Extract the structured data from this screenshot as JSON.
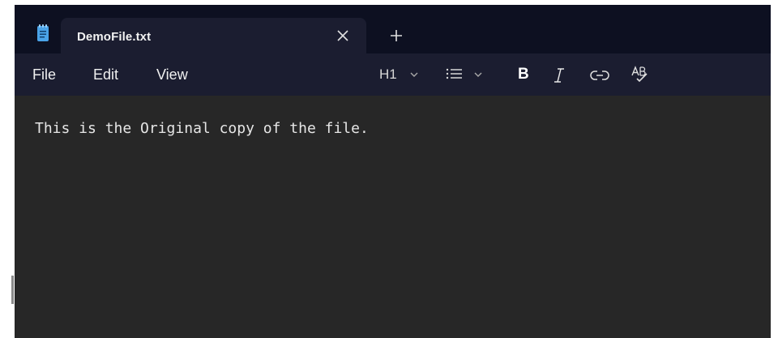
{
  "window": {
    "tab_title": "DemoFile.txt"
  },
  "menu": {
    "items": [
      "File",
      "Edit",
      "View"
    ]
  },
  "toolbar": {
    "heading_label": "H1",
    "bold_label": "B"
  },
  "editor": {
    "content": "This is the Original copy of the file."
  },
  "icons": {
    "app": "notepad-icon",
    "close": "close-icon",
    "new_tab": "plus-icon",
    "heading_dropdown": "chevron-down-icon",
    "list": "list-icon",
    "list_dropdown": "chevron-down-icon",
    "italic": "italic-icon",
    "link": "link-icon",
    "spellcheck": "spellcheck-icon"
  },
  "colors": {
    "titlebar": "#0d1021",
    "tab_and_menubar": "#1b1d30",
    "editor_background": "#272727",
    "app_icon": "#4aa3e8"
  }
}
